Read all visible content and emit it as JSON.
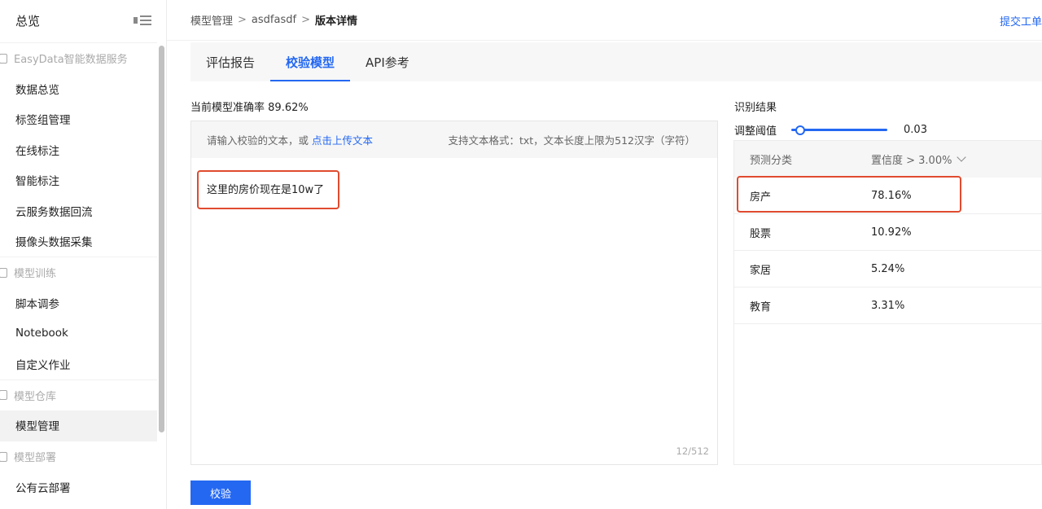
{
  "sidebar": {
    "title": "总览",
    "sections": [
      {
        "label": "EasyData智能数据服务",
        "items": [
          "数据总览",
          "标签组管理",
          "在线标注",
          "智能标注",
          "云服务数据回流",
          "摄像头数据采集"
        ]
      },
      {
        "label": "模型训练",
        "items": [
          "脚本调参",
          "Notebook",
          "自定义作业"
        ]
      },
      {
        "label": "模型仓库",
        "items": [
          "模型管理"
        ]
      },
      {
        "label": "模型部署",
        "items": [
          "公有云部署"
        ]
      }
    ],
    "active_item": "模型管理"
  },
  "breadcrumb": {
    "items": [
      "模型管理",
      "asdfasdf",
      "版本详情"
    ],
    "separator": ">"
  },
  "header": {
    "submit_link": "提交工单"
  },
  "tabs": [
    {
      "label": "评估报告",
      "active": false
    },
    {
      "label": "校验模型",
      "active": true
    },
    {
      "label": "API参考",
      "active": false
    }
  ],
  "accuracy": {
    "label": "当前模型准确率",
    "value": "89.62%"
  },
  "input": {
    "prompt": "请输入校验的文本，或",
    "upload_link": "点击上传文本",
    "format_hint": "支持文本格式：txt，文本长度上限为512汉字（字符）",
    "value": "这里的房价现在是10w了",
    "counter": "12/512"
  },
  "verify_button": "校验",
  "results": {
    "title": "识别结果",
    "threshold_label": "调整阈值",
    "threshold_value": "0.03",
    "col_category": "预测分类",
    "col_confidence": "置信度 > 3.00%",
    "rows": [
      {
        "category": "房产",
        "confidence": "78.16%"
      },
      {
        "category": "股票",
        "confidence": "10.92%"
      },
      {
        "category": "家居",
        "confidence": "5.24%"
      },
      {
        "category": "教育",
        "confidence": "3.31%"
      }
    ]
  },
  "colors": {
    "accent": "#2468f2",
    "highlight": "#e04b2f"
  }
}
